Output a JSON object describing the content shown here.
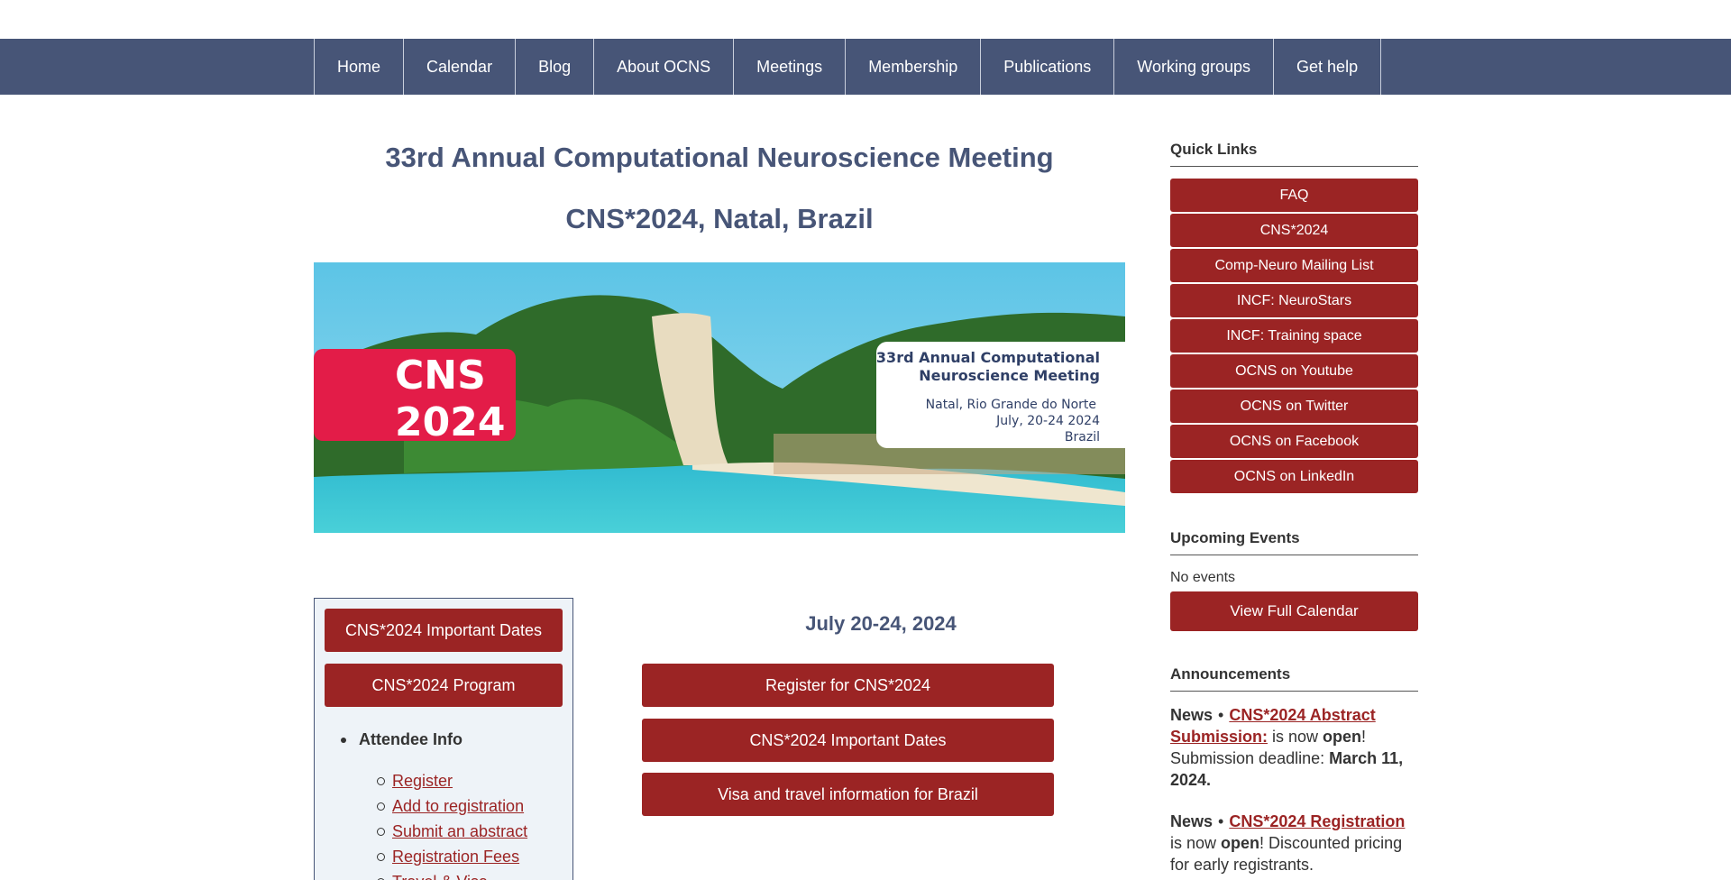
{
  "nav": [
    "Home",
    "Calendar",
    "Blog",
    "About OCNS",
    "Meetings",
    "Membership",
    "Publications",
    "Working groups",
    "Get help"
  ],
  "main": {
    "title": "33rd Annual Computational Neuroscience Meeting",
    "subtitle": "CNS*2024, Natal, Brazil",
    "banner": {
      "logo_line1": "CNS",
      "logo_line2": "2024",
      "heading_line1": "33rd Annual Computational",
      "heading_line2": "Neuroscience Meeting",
      "place": "Natal, Rio Grande do Norte",
      "date": "July, 20-24 2024",
      "country": "Brazil"
    },
    "dates": "July 20-24, 2024",
    "buttons": [
      "Register for CNS*2024",
      "CNS*2024 Important Dates",
      "Visa and travel information for Brazil"
    ]
  },
  "left": {
    "buttons": [
      "CNS*2024 Important Dates",
      "CNS*2024 Program"
    ],
    "attendee_heading": "Attendee Info",
    "links": [
      "Register",
      "Add to registration",
      "Submit an abstract",
      "Registration Fees",
      "Travel & Visa"
    ]
  },
  "right": {
    "quick_links_heading": "Quick Links",
    "quick_links": [
      "FAQ",
      "CNS*2024",
      "Comp-Neuro Mailing List",
      "INCF: NeuroStars",
      "INCF: Training space",
      "OCNS on Youtube",
      "OCNS on Twitter",
      "OCNS on Facebook",
      "OCNS on LinkedIn"
    ],
    "upcoming_heading": "Upcoming Events",
    "no_events": "No events",
    "view_calendar": "View Full Calendar",
    "announcements_heading": "Announcements",
    "news": [
      {
        "label": "News",
        "link": "CNS*2024 Abstract Submission:",
        "t1": " is now ",
        "b1": "open",
        "t2": "! Submission deadline: ",
        "b2": "March 11, 2024."
      },
      {
        "label": "News",
        "link": "CNS*2024 Registration",
        "t1": " is now ",
        "b1": "open",
        "t2": "! Discounted pricing for early registrants.",
        "b2": ""
      }
    ]
  },
  "colors": {
    "nav_bg": "#475577",
    "button_red": "#9b2424",
    "logo_red": "#e31c48",
    "heading_blue": "#475577"
  }
}
